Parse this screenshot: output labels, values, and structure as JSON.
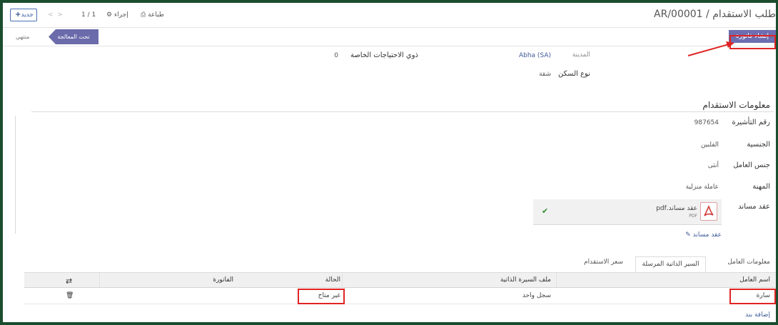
{
  "header": {
    "title": "طلب الاستقدام / AR/00001",
    "new_label": "جديد",
    "pager": "1 / 1",
    "action_label": "إجراء",
    "print_label": "طباعة"
  },
  "statusbar": {
    "create_invoice_label": "إنشاء فاتورة",
    "stage_active": "تحت المعالجة",
    "stage_done": "منتهي"
  },
  "fields": {
    "city_label": "المدينة",
    "city_value": "Abha (SA)",
    "special_needs_label": "ذوي الاحتياجات الخاصة",
    "special_needs_value": "0",
    "housing_label": "نوع السكن",
    "housing_value": "شقة"
  },
  "recruitment": {
    "section_title": "معلومات الاستقدام",
    "visa_label": "رقم التأشيرة",
    "visa_value": "987654",
    "nationality_label": "الجنسية",
    "nationality_value": "الفلبين",
    "gender_label": "جنس العامل",
    "gender_value": "أنثى",
    "profession_label": "المهنة",
    "profession_value": "عاملة منزلية",
    "contract_label": "عقد مساند",
    "file_name": "عقد مساند.pdf",
    "file_ext": "PDF",
    "attach_label": "عقد مساند"
  },
  "tabs": [
    {
      "label": "معلومات العامل"
    },
    {
      "label": "السير الذاتية المرسلة"
    },
    {
      "label": "سعر الاستقدام"
    }
  ],
  "table": {
    "columns": [
      "اسم العامل",
      "ملف السيرة الذاتية",
      "الحالة",
      "الفاتورة"
    ],
    "rows": [
      {
        "worker": "سارة",
        "cv": "سجل واحد",
        "status": "غير متاح",
        "invoice": ""
      }
    ],
    "add_line_label": "إضافة بند"
  },
  "colors": {
    "accent": "#6c6eb0",
    "highlight": "#e02424",
    "frame": "#1a4d2e"
  }
}
